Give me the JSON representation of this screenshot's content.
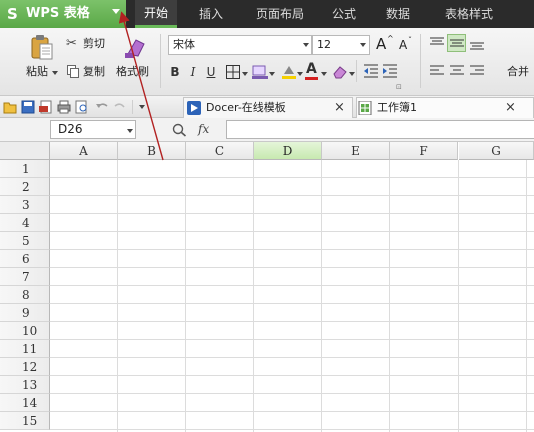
{
  "app": {
    "logo": "S",
    "title": "WPS 表格"
  },
  "menu": {
    "tabs": [
      {
        "label": "开始",
        "active": true
      },
      {
        "label": "插入",
        "active": false
      },
      {
        "label": "页面布局",
        "active": false
      },
      {
        "label": "公式",
        "active": false
      },
      {
        "label": "数据",
        "active": false
      },
      {
        "label": "表格样式",
        "active": false
      }
    ]
  },
  "ribbon": {
    "paste_label": "粘贴",
    "cut_label": "剪切",
    "copy_label": "复制",
    "format_painter_label": "格式刷",
    "font_name": "宋体",
    "font_size": "12",
    "bold": "B",
    "italic": "I",
    "underline": "U",
    "grow_font": "A",
    "shrink_font": "A",
    "merge_label": "合并",
    "font_color": "#d42020",
    "highlight_color": "#f5d000"
  },
  "quickbar": {
    "tabs": [
      {
        "label": "Docer-在线模板",
        "icon": "docer-icon"
      },
      {
        "label": "工作簿1",
        "icon": "workbook-icon"
      }
    ],
    "close_glyph": "×"
  },
  "formula_bar": {
    "cell_ref": "D26",
    "fx": "fx",
    "value": ""
  },
  "grid": {
    "columns": [
      "A",
      "B",
      "C",
      "D",
      "E",
      "F",
      "G"
    ],
    "active_column": "D",
    "rows": [
      "1",
      "2",
      "3",
      "4",
      "5",
      "6",
      "7",
      "8",
      "9",
      "10",
      "11",
      "12",
      "13",
      "14",
      "15"
    ]
  },
  "colors": {
    "app_green": "#5aa847",
    "menubar": "#2b2b2b",
    "annotation_arrow": "#b22222"
  }
}
